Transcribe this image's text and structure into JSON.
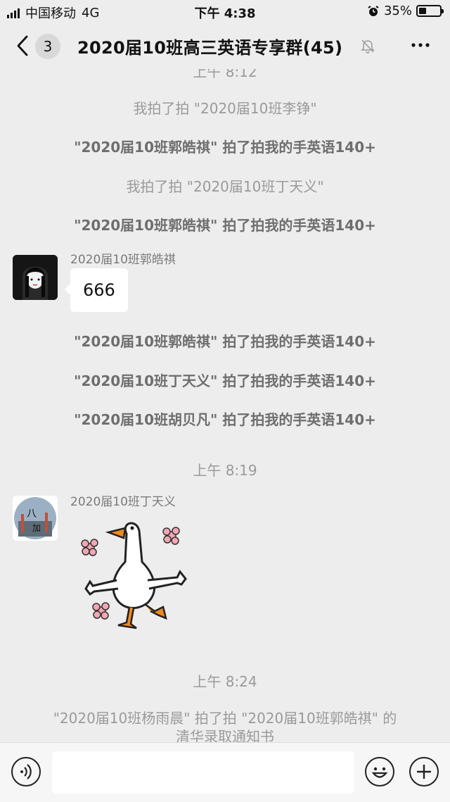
{
  "status_bar": {
    "carrier": "中国移动",
    "network": "4G",
    "time": "下午 4:38",
    "battery_percent": "35%",
    "battery_level": 0.35
  },
  "nav": {
    "back_icon": "chevron-left-icon",
    "unread_count": "3",
    "title": "2020届10班高三英语专享群(45)",
    "mute_icon": "bell-muted-icon",
    "more_icon": "more-dots-icon"
  },
  "messages": {
    "time_top_partial": "上午 8:12",
    "sys1": "我拍了拍 \"2020届10班李铮\"",
    "sys2": "\"2020届10班郭皓祺\" 拍了拍我的手英语140+",
    "sys3": "我拍了拍 \"2020届10班丁天义\"",
    "sys4": "\"2020届10班郭皓祺\" 拍了拍我的手英语140+",
    "msg1_sender": "2020届10班郭皓祺",
    "msg1_text": "666",
    "sys5": "\"2020届10班郭皓祺\" 拍了拍我的手英语140+",
    "sys6": "\"2020届10班丁天义\" 拍了拍我的手英语140+",
    "sys7": "\"2020届10班胡贝凡\" 拍了拍我的手英语140+",
    "time2": "上午 8:19",
    "msg2_sender": "2020届10班丁天义",
    "time3": "上午 8:24",
    "sys8_line1": "\"2020届10班杨雨晨\" 拍了拍 \"2020届10班郭皓祺\" 的",
    "sys8_line2": "清华录取通知书"
  },
  "input_bar": {
    "voice_icon": "voice-icon",
    "text_value": "",
    "emoji_icon": "emoji-icon",
    "plus_icon": "plus-icon"
  }
}
